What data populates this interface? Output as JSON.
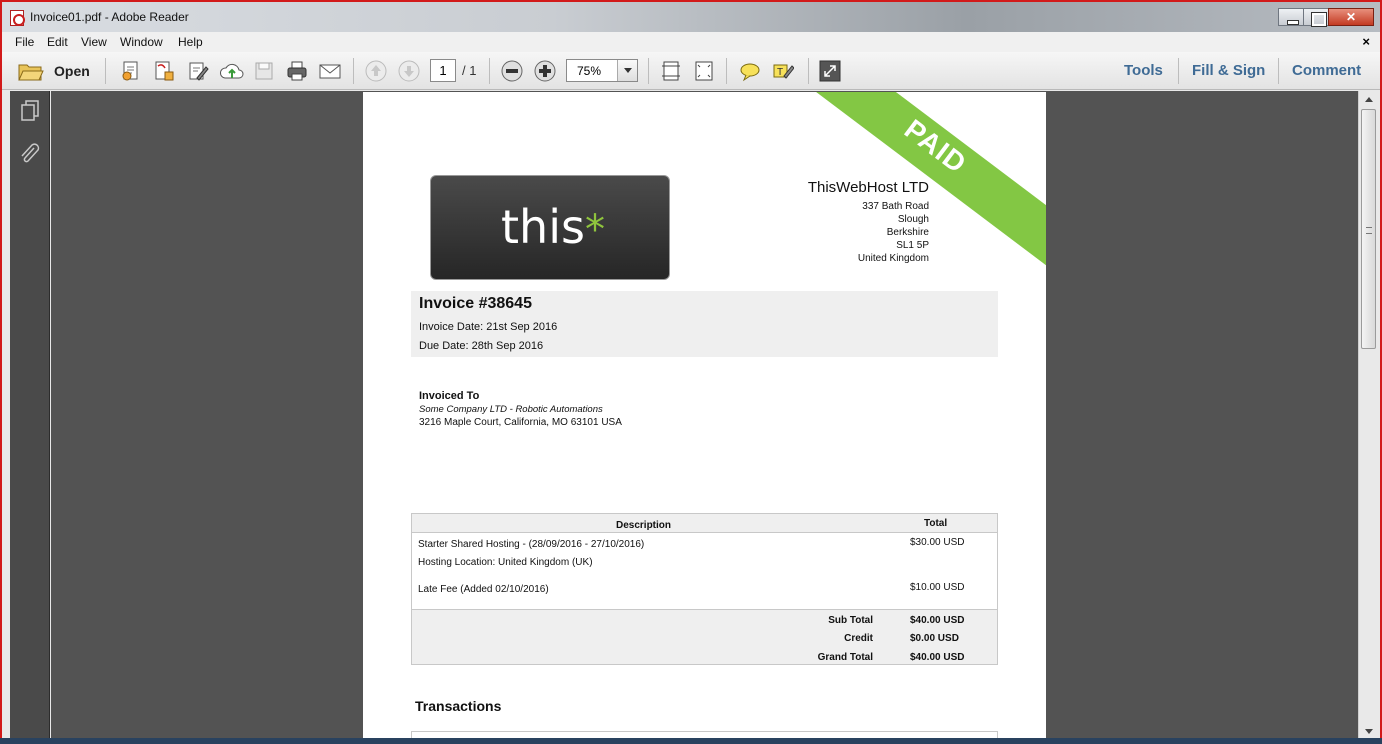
{
  "window": {
    "title": "Invoice01.pdf - Adobe Reader"
  },
  "menubar": {
    "items": [
      "File",
      "Edit",
      "View",
      "Window",
      "Help"
    ],
    "close_glyph": "×"
  },
  "toolbar": {
    "open_label": "Open",
    "page_current": "1",
    "page_total": "/ 1",
    "zoom": "75%",
    "right_tabs": [
      "Tools",
      "Fill & Sign",
      "Comment"
    ],
    "icons": [
      "folder-open-icon",
      "create-pdf-icon",
      "export-pdf-icon",
      "edit-pdf-icon",
      "upload-cloud-icon",
      "save-icon",
      "print-icon",
      "email-icon",
      "page-up-icon",
      "page-down-icon",
      "zoom-out-icon",
      "zoom-in-icon",
      "fit-width-icon",
      "fit-page-icon",
      "sticky-note-icon",
      "highlight-icon",
      "fullscreen-icon"
    ]
  },
  "document": {
    "stamp": "PAID",
    "logo_text": "this",
    "logo_mark": "*",
    "company": {
      "name": "ThisWebHost LTD",
      "address": [
        "337 Bath Road",
        "Slough",
        "Berkshire",
        "SL1 5P",
        "United Kingdom"
      ]
    },
    "invoice": {
      "number": "Invoice #38645",
      "date": "Invoice Date: 21st Sep 2016",
      "due": "Due Date: 28th Sep 2016"
    },
    "invoiced_to": {
      "heading": "Invoiced To",
      "company": "Some Company LTD - Robotic Automations",
      "address": "3216 Maple Court,   California, MO 63101 USA"
    },
    "table": {
      "headers": [
        "Description",
        "Total"
      ],
      "rows": [
        {
          "desc": "Starter Shared Hosting - (28/09/2016 - 27/10/2016)",
          "amount": "$30.00 USD"
        },
        {
          "desc": "Hosting Location: United Kingdom (UK)",
          "amount": ""
        },
        {
          "desc": "Late Fee (Added 02/10/2016)",
          "amount": "$10.00 USD"
        }
      ],
      "totals": [
        {
          "label": "Sub Total",
          "value": "$40.00 USD"
        },
        {
          "label": "Credit",
          "value": "$0.00 USD"
        },
        {
          "label": "Grand Total",
          "value": "$40.00 USD"
        }
      ]
    },
    "transactions_heading": "Transactions"
  }
}
